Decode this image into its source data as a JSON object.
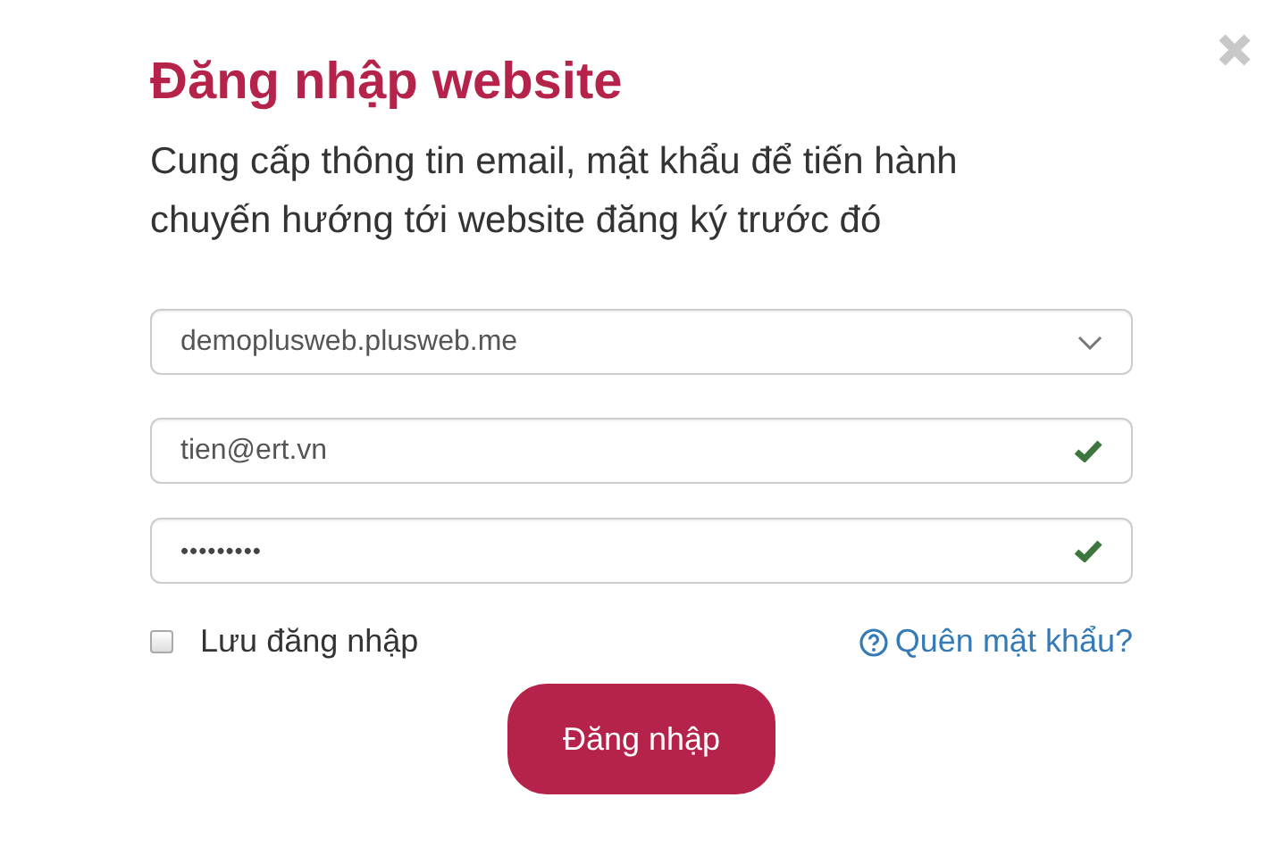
{
  "title": "Đăng nhập website",
  "subtitle": "Cung cấp thông tin email, mật khẩu để tiến hành chuyến hướng tới website đăng ký trước đó",
  "website_select": {
    "value": "demoplusweb.plusweb.me"
  },
  "fields": [
    {
      "kind": "email",
      "value": "tien@ert.vn",
      "valid": true
    },
    {
      "kind": "password",
      "value": "•••••••••",
      "valid": true
    }
  ],
  "remember": {
    "label": "Lưu đăng nhập",
    "checked": false
  },
  "forgot_link": "Quên mật khẩu?",
  "submit_button": "Đăng nhập"
}
